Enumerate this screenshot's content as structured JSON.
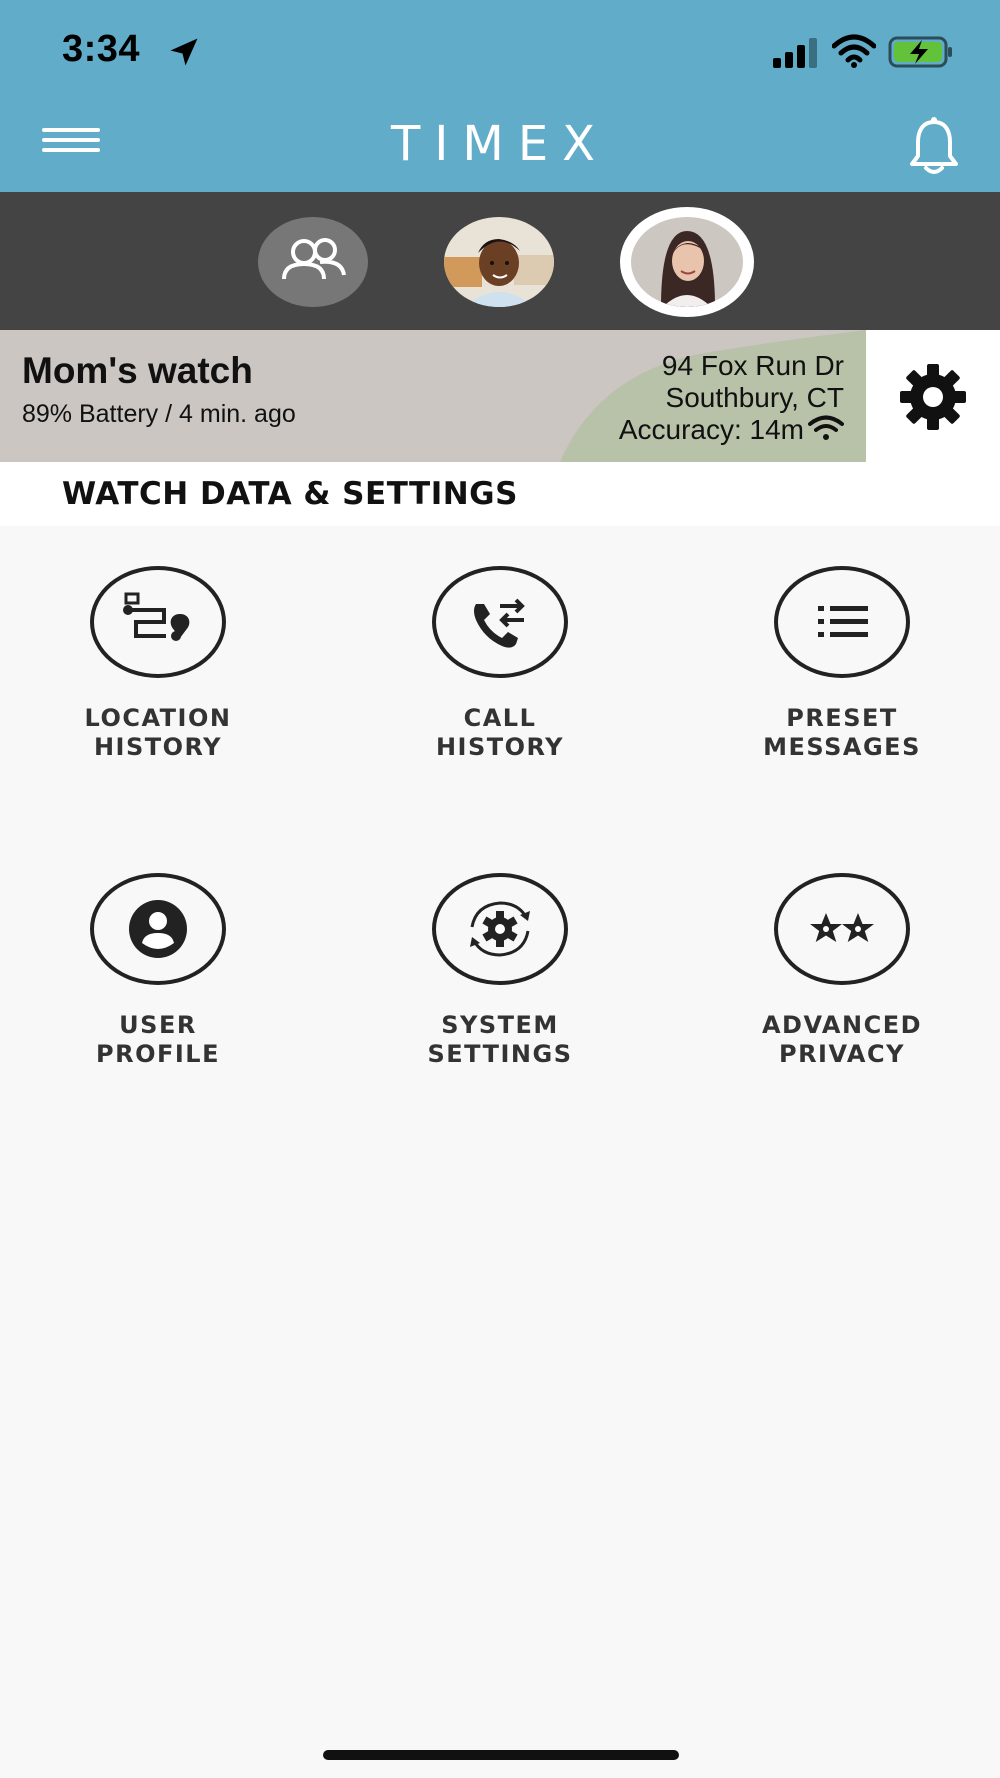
{
  "status_bar": {
    "time": "3:34"
  },
  "header": {
    "brand": "TIMEX",
    "bg_color": "#61adc9"
  },
  "avatars": [
    {
      "name": "group",
      "icon": "group-icon",
      "selected": false
    },
    {
      "name": "child",
      "selected": false
    },
    {
      "name": "mom",
      "selected": true
    }
  ],
  "watch_card": {
    "name": "Mom's watch",
    "battery_line": "89% Battery / 4 min. ago",
    "address_line1": "94 Fox Run Dr",
    "address_line2": "Southbury, CT",
    "accuracy": "Accuracy: 14m"
  },
  "section": {
    "title": "WATCH DATA & SETTINGS"
  },
  "tiles": [
    {
      "line1": "LOCATION",
      "line2": "HISTORY",
      "icon": "route-pin-icon"
    },
    {
      "line1": "CALL",
      "line2": "HISTORY",
      "icon": "phone-arrows-icon"
    },
    {
      "line1": "PRESET",
      "line2": "MESSAGES",
      "icon": "list-icon"
    },
    {
      "line1": "USER",
      "line2": "PROFILE",
      "icon": "user-circle-icon"
    },
    {
      "line1": "SYSTEM",
      "line2": "SETTINGS",
      "icon": "gear-sync-icon"
    },
    {
      "line1": "ADVANCED",
      "line2": "PRIVACY",
      "icon": "stars-icon"
    }
  ]
}
